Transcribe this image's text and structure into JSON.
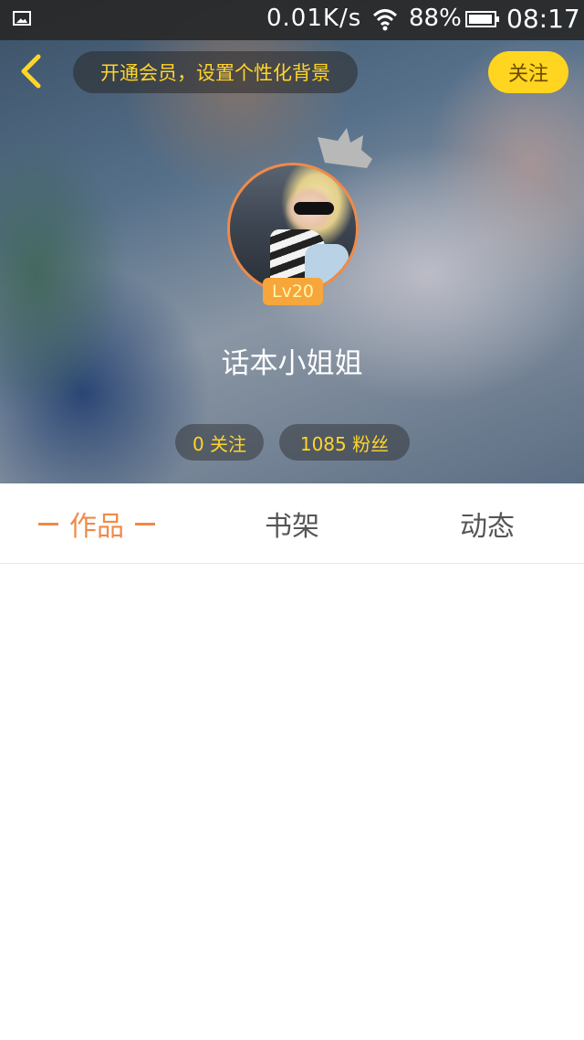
{
  "status_bar": {
    "net_speed": "0.01K/s",
    "battery_percent": "88%",
    "time": "08:17",
    "icons": [
      "gallery-icon",
      "wifi-icon",
      "battery-icon"
    ]
  },
  "top_nav": {
    "promo_text": "开通会员，设置个性化背景",
    "follow_label": "关注",
    "back_icon": "chevron-left-icon"
  },
  "profile": {
    "level": "Lv20",
    "username": "话本小姐姐",
    "following": "0 关注",
    "fans": "1085 粉丝"
  },
  "tabs": [
    {
      "label": "作品",
      "active": true
    },
    {
      "label": "书架",
      "active": false
    },
    {
      "label": "动态",
      "active": false
    }
  ],
  "colors": {
    "accent": "#f08a48",
    "yellow": "#ffd52a",
    "follow_button": "#ffd51f"
  }
}
